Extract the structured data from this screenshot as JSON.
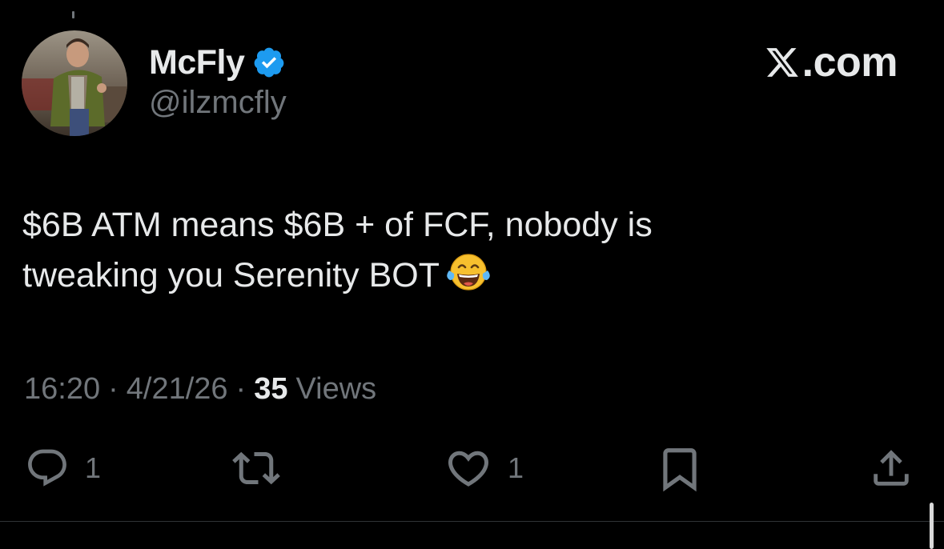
{
  "author": {
    "display_name": "McFly",
    "handle": "@ilzmcfly",
    "verified": true,
    "verified_color": "#1d9bf0",
    "avatar": "avatar-photo"
  },
  "brand": {
    "logo": "x-logo-icon",
    "domain": ".com"
  },
  "tweet": {
    "text": "$6B ATM means $6B + of FCF, nobody is\ntweaking you Serenity BOT",
    "emoji": "face-with-tears-of-joy-icon"
  },
  "meta": {
    "time": "16:20",
    "separator": "·",
    "date": "4/21/26",
    "views_count": "35",
    "views_label": "Views"
  },
  "actions": {
    "reply_count": "1",
    "repost_count": "",
    "like_count": "1"
  },
  "colors": {
    "background": "#000000",
    "text_primary": "#e7e9ea",
    "text_secondary": "#71767b",
    "accent": "#1d9bf0"
  }
}
